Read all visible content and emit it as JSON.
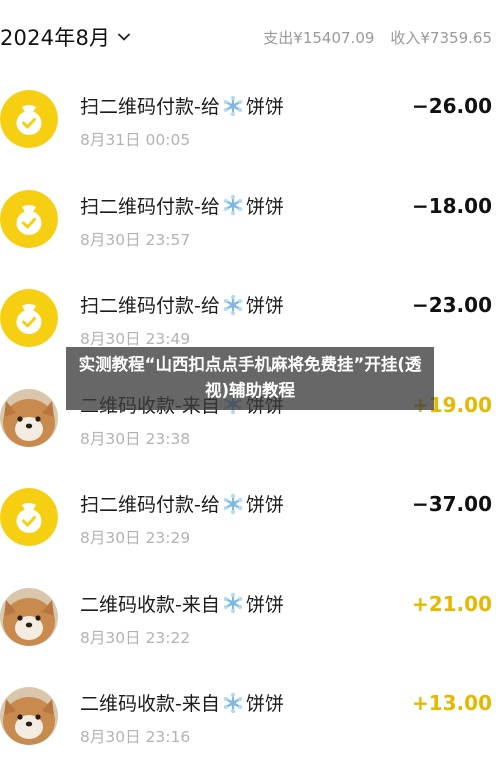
{
  "header": {
    "month": "2024年8月",
    "expense": "支出¥15407.09",
    "income": "收入¥7359.65"
  },
  "colors": {
    "income_amount": "#e6b800",
    "wallet_icon_bg": "#f7cf12"
  },
  "transactions": [
    {
      "kind": "out",
      "icon": "wallet-icon",
      "prefix": "扫二维码付款-给",
      "name": "饼饼",
      "time": "8月31日 00:05",
      "amount": "−26.00"
    },
    {
      "kind": "out",
      "icon": "wallet-icon",
      "prefix": "扫二维码付款-给",
      "name": "饼饼",
      "time": "8月30日 23:57",
      "amount": "−18.00"
    },
    {
      "kind": "out",
      "icon": "wallet-icon",
      "prefix": "扫二维码付款-给",
      "name": "饼饼",
      "time": "8月30日 23:49",
      "amount": "−23.00"
    },
    {
      "kind": "in",
      "icon": "dog-avatar",
      "prefix": "二维码收款-来自",
      "name": "饼饼",
      "time": "8月30日 23:38",
      "amount": "+19.00"
    },
    {
      "kind": "out",
      "icon": "wallet-icon",
      "prefix": "扫二维码付款-给",
      "name": "饼饼",
      "time": "8月30日 23:29",
      "amount": "−37.00"
    },
    {
      "kind": "in",
      "icon": "dog-avatar",
      "prefix": "二维码收款-来自",
      "name": "饼饼",
      "time": "8月30日 23:22",
      "amount": "+21.00"
    },
    {
      "kind": "in",
      "icon": "dog-avatar",
      "prefix": "二维码收款-来自",
      "name": "饼饼",
      "time": "8月30日 23:16",
      "amount": "+13.00"
    }
  ],
  "watermark": {
    "text": "实测教程“山西扣点点手机麻将免费挂”开挂(透视)辅助教程"
  }
}
